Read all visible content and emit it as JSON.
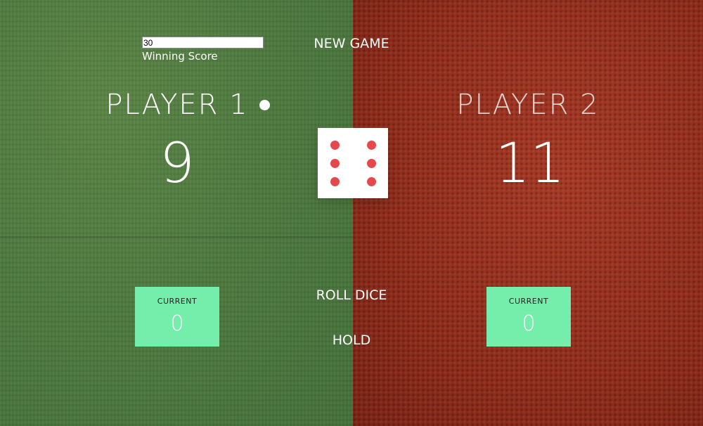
{
  "controls": {
    "new_game": "NEW GAME",
    "roll_dice": "ROLL DICE",
    "hold": "HOLD",
    "winning_score_value": "30",
    "winning_score_label": "Winning Score"
  },
  "players": [
    {
      "name": "PLAYER 1",
      "score": "9",
      "current_label": "CURRENT",
      "current_value": "0",
      "active": true
    },
    {
      "name": "PLAYER 2",
      "score": "11",
      "current_label": "CURRENT",
      "current_value": "0",
      "active": false
    }
  ],
  "dice": {
    "face": 6
  },
  "colors": {
    "left_panel": "#4e7a3f",
    "right_panel": "#8f2d1c",
    "current_box": "#74eeaa",
    "dice_pip": "#e5484a"
  }
}
